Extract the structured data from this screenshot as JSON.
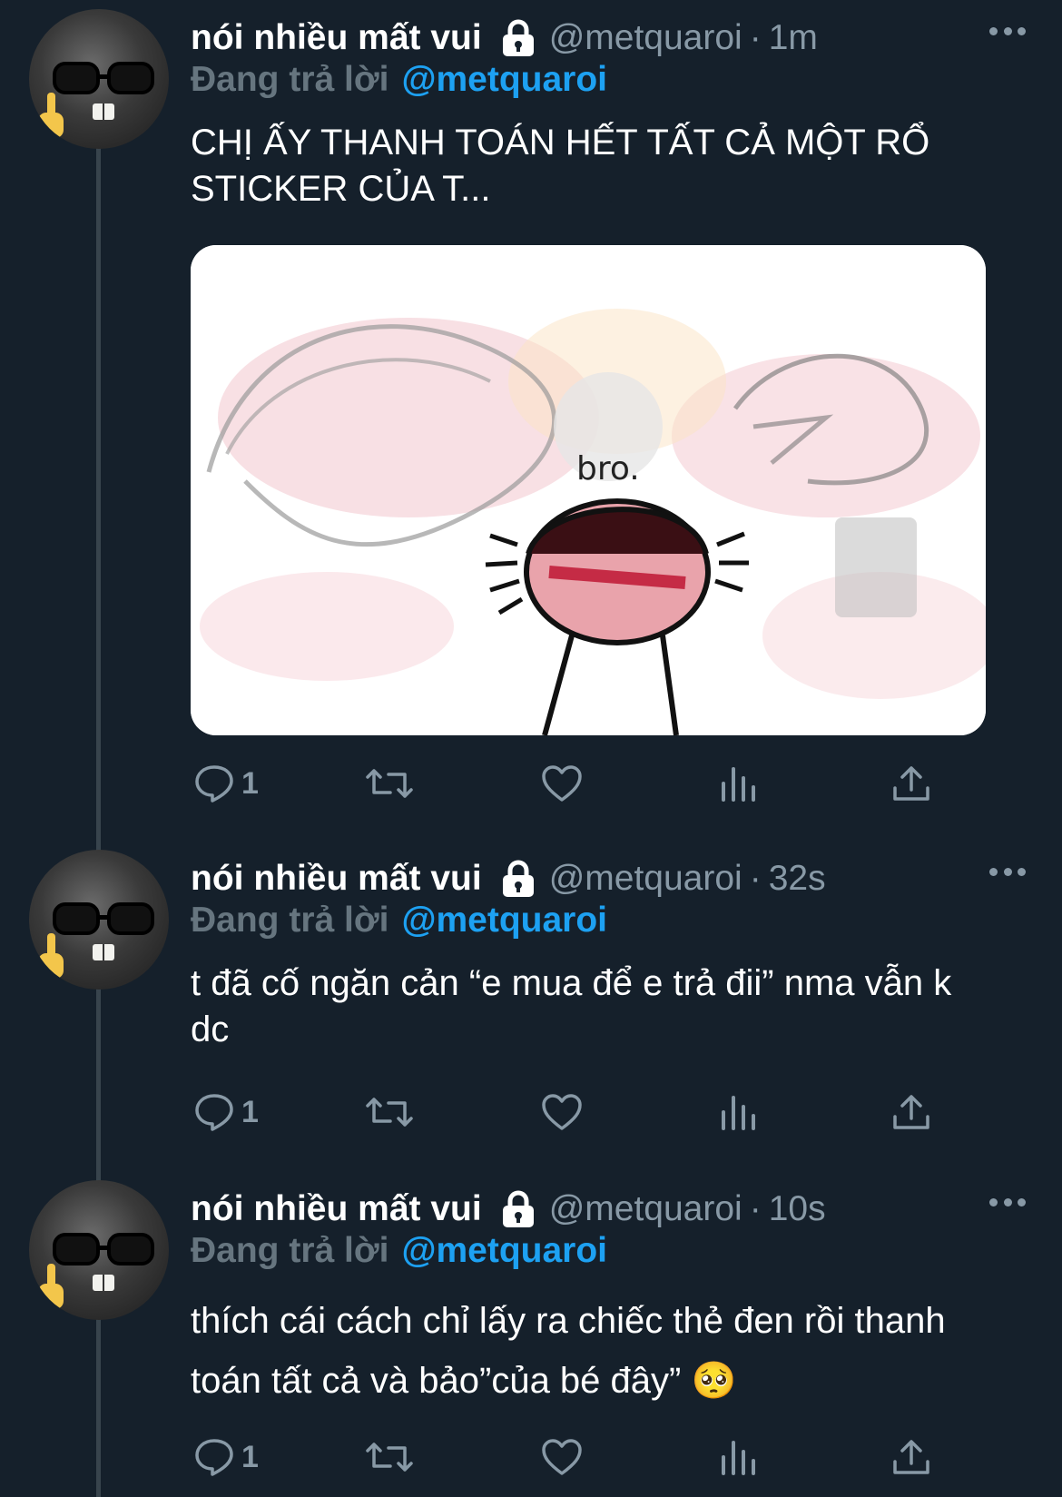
{
  "tweets": [
    {
      "author": "nói nhiều mất vui",
      "handle": "@metquaroi",
      "separator": "·",
      "time": "1m",
      "reply_label": "Đang trả lời",
      "reply_to": "@metquaroi",
      "text": "CHỊ ẤY THANH TOÁN HẾT TẤT CẢ MỘT RỔ STICKER CỦA T...",
      "media": {
        "caption_in_image": "bro."
      },
      "reply_count": "1"
    },
    {
      "author": "nói nhiều mất vui",
      "handle": "@metquaroi",
      "separator": "·",
      "time": "32s",
      "reply_label": "Đang trả lời",
      "reply_to": "@metquaroi",
      "text": "t đã cố ngăn cản “e mua để e trả đii” nma vẫn k dc",
      "reply_count": "1"
    },
    {
      "author": "nói nhiều mất vui",
      "handle": "@metquaroi",
      "separator": "·",
      "time": "10s",
      "reply_label": "Đang trả lời",
      "reply_to": "@metquaroi",
      "text": "thích cái cách chỉ lấy ra chiếc thẻ đen rồi thanh toán tất cả và bảo”của bé đây” 🥺",
      "reply_count": "1"
    }
  ],
  "colors": {
    "background": "#15202b",
    "secondary_text": "#8899a6",
    "link": "#1da1f2",
    "thread_line": "#38444d"
  },
  "icons": [
    "lock-icon",
    "more-icon",
    "reply-icon",
    "retweet-icon",
    "like-icon",
    "analytics-icon",
    "share-icon"
  ]
}
